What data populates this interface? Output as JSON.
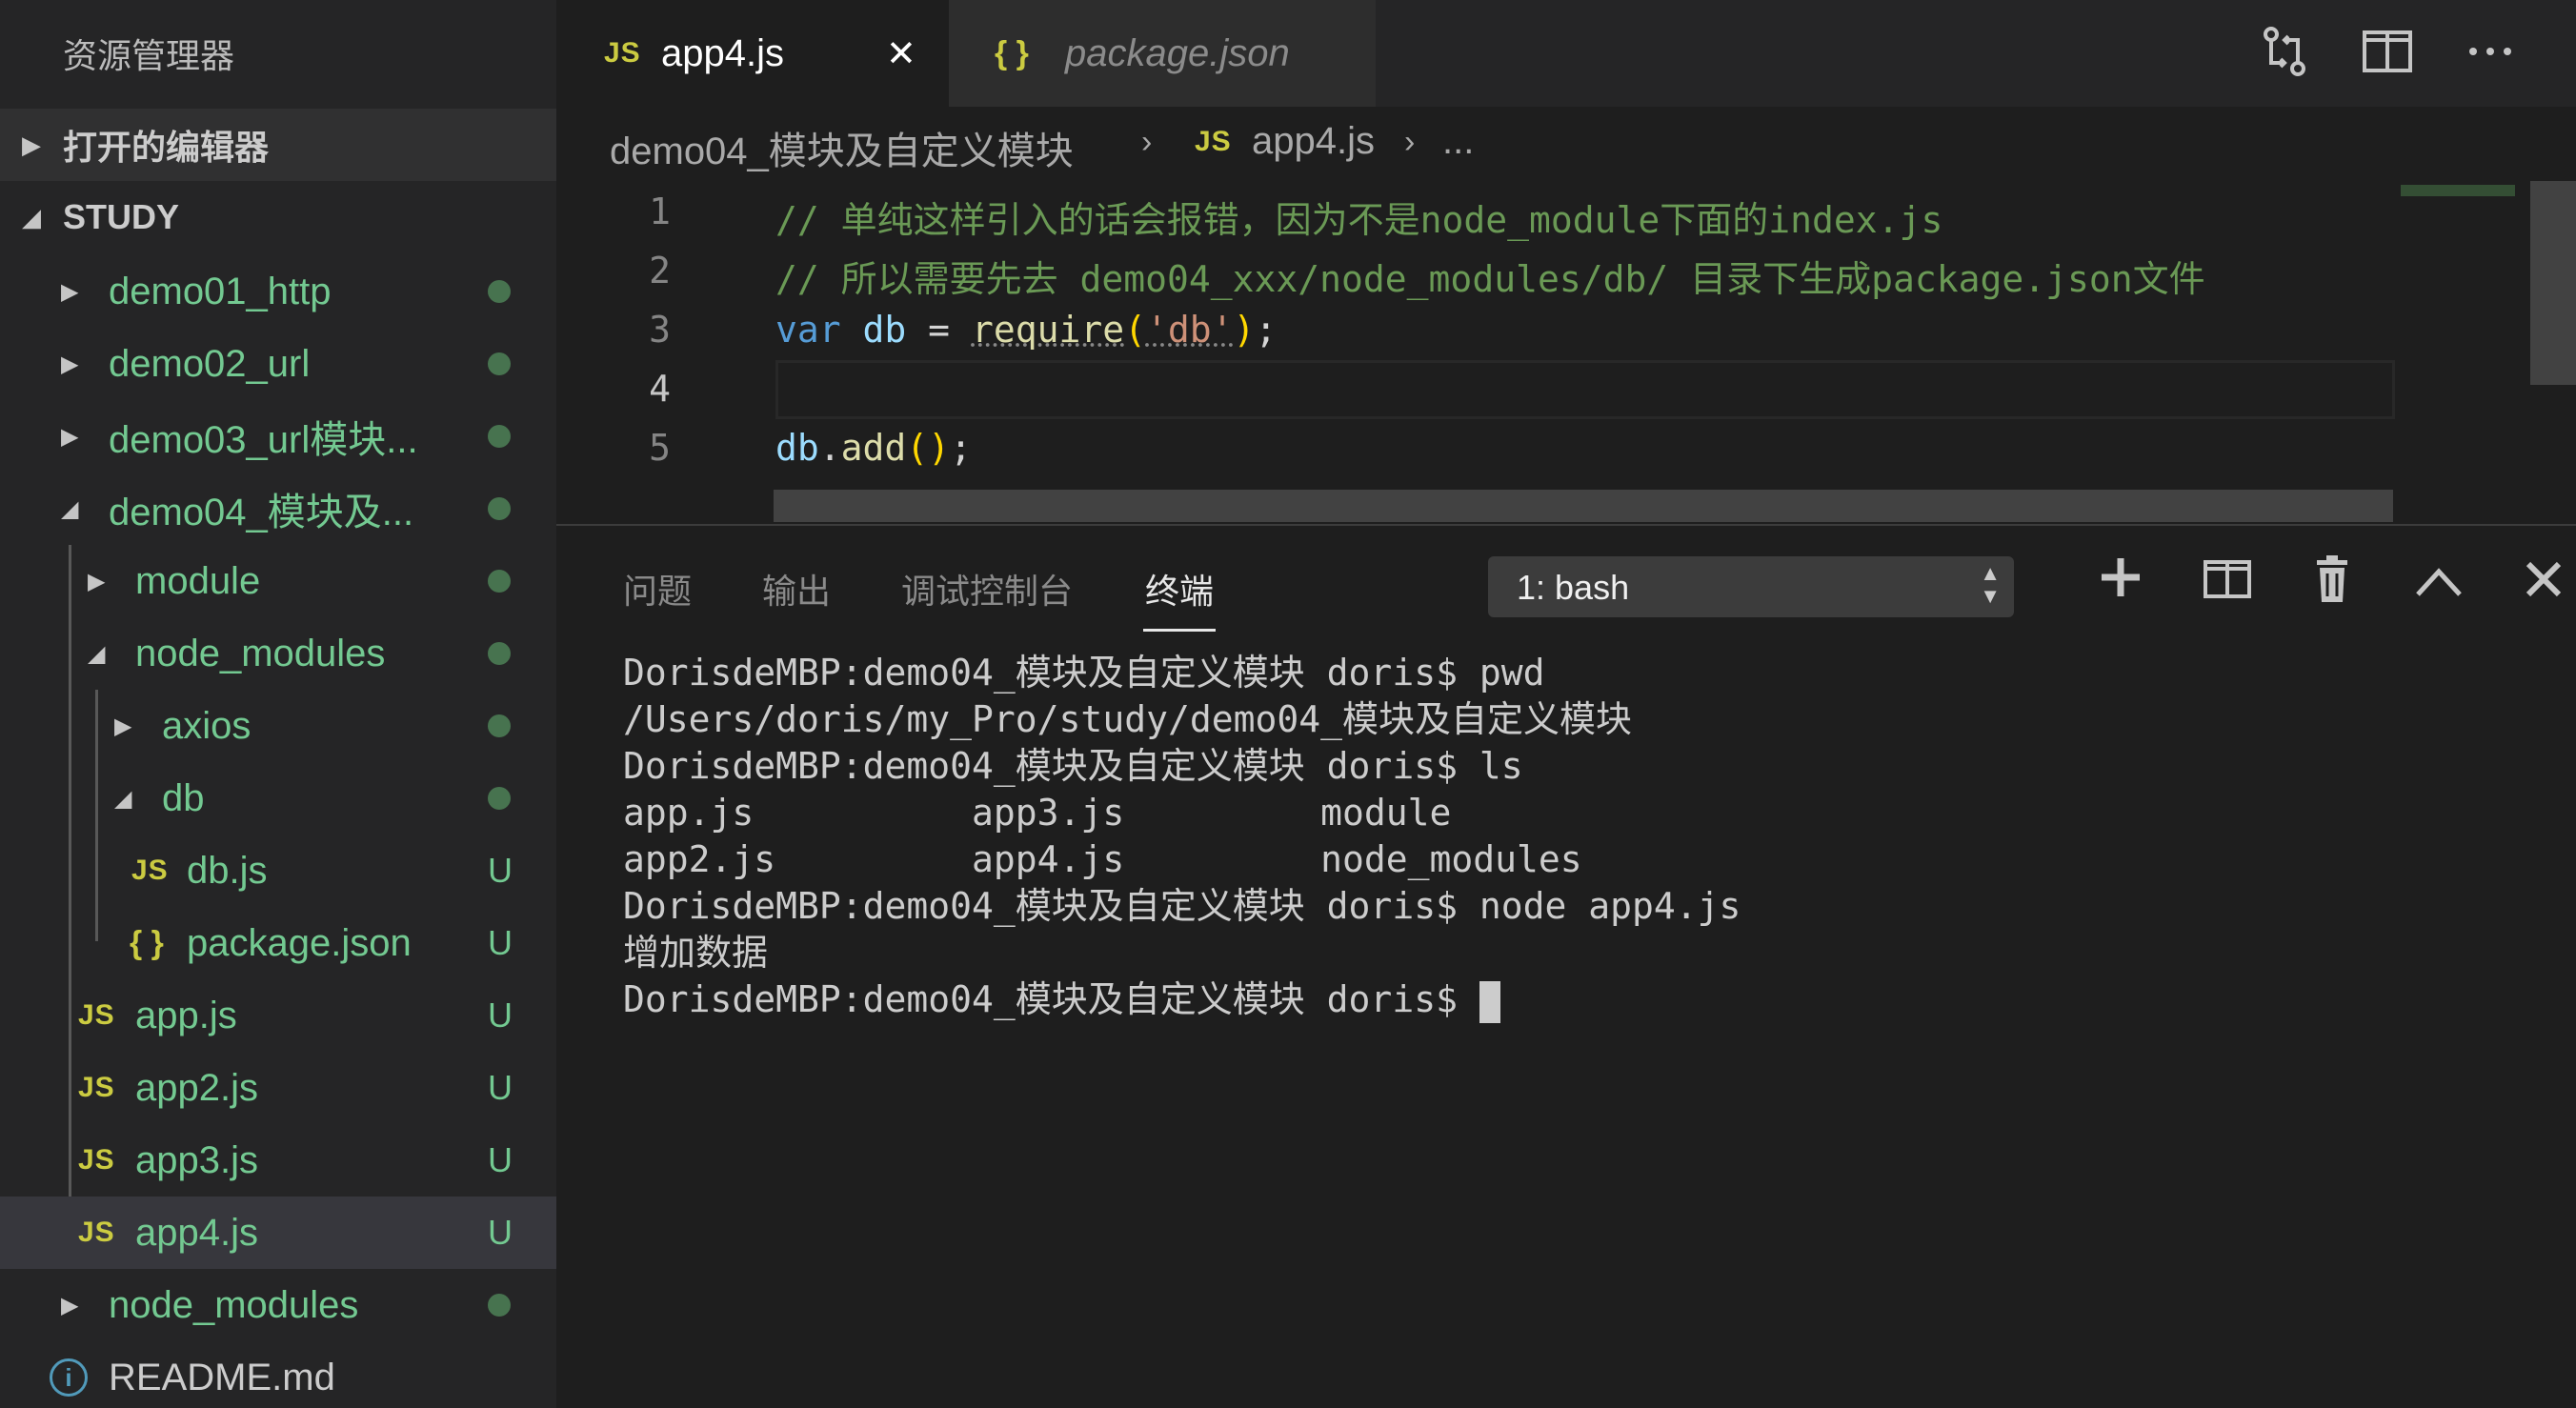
{
  "sidebar": {
    "title": "资源管理器",
    "open_editors": "打开的编辑器",
    "workspace": "STUDY",
    "items": [
      {
        "label": "demo01_http",
        "status": "dot"
      },
      {
        "label": "demo02_url",
        "status": "dot"
      },
      {
        "label": "demo03_url模块...",
        "status": "dot"
      },
      {
        "label": "demo04_模块及...",
        "status": "dot"
      },
      {
        "label": "module",
        "status": "dot"
      },
      {
        "label": "node_modules",
        "status": "dot"
      },
      {
        "label": "axios",
        "status": "dot"
      },
      {
        "label": "db",
        "status": "dot"
      },
      {
        "label": "db.js",
        "status": "U",
        "icon": "JS"
      },
      {
        "label": "package.json",
        "status": "U",
        "icon": "{ }"
      },
      {
        "label": "app.js",
        "status": "U",
        "icon": "JS"
      },
      {
        "label": "app2.js",
        "status": "U",
        "icon": "JS"
      },
      {
        "label": "app3.js",
        "status": "U",
        "icon": "JS"
      },
      {
        "label": "app4.js",
        "status": "U",
        "icon": "JS"
      },
      {
        "label": "node_modules",
        "status": "dot"
      },
      {
        "label": "README.md",
        "icon": "i"
      }
    ]
  },
  "tabs": [
    {
      "icon": "JS",
      "label": "app4.js",
      "close": "✕"
    },
    {
      "icon": "{ }",
      "label": "package.json"
    }
  ],
  "breadcrumb": {
    "folder": "demo04_模块及自定义模块",
    "sep": "›",
    "file_icon": "JS",
    "file": "app4.js",
    "more": "..."
  },
  "code": {
    "line_numbers": [
      "1",
      "2",
      "3",
      "4",
      "5"
    ],
    "line1": "// 单纯这样引入的话会报错，因为不是node_module下面的index.js",
    "line2": "// 所以需要先去 demo04_xxx/node_modules/db/ 目录下生成package.json文件",
    "line3": {
      "kw": "var",
      "var": "db",
      "eq": " = ",
      "fn": "require",
      "open": "(",
      "str": "'db'",
      "close": ")",
      "semi": ";"
    },
    "line5": {
      "obj": "db",
      "dot": ".",
      "fn": "add",
      "parens": "()",
      "semi": ";"
    }
  },
  "panel": {
    "tabs": [
      "问题",
      "输出",
      "调试控制台",
      "终端"
    ],
    "active_tab": "终端",
    "terminal_select": "1: bash",
    "terminal_lines": [
      "DorisdeMBP:demo04_模块及自定义模块 doris$ pwd",
      "/Users/doris/my_Pro/study/demo04_模块及自定义模块",
      "DorisdeMBP:demo04_模块及自定义模块 doris$ ls",
      "app.js          app3.js         module",
      "app2.js         app4.js         node_modules",
      "DorisdeMBP:demo04_模块及自定义模块 doris$ node app4.js",
      "增加数据",
      "DorisdeMBP:demo04_模块及自定义模块 doris$ "
    ]
  },
  "colors": {
    "sidebar_bg": "#252526",
    "editor_bg": "#1e1e1e",
    "git_untracked": "#73c991",
    "js_icon": "#cbcb41"
  }
}
